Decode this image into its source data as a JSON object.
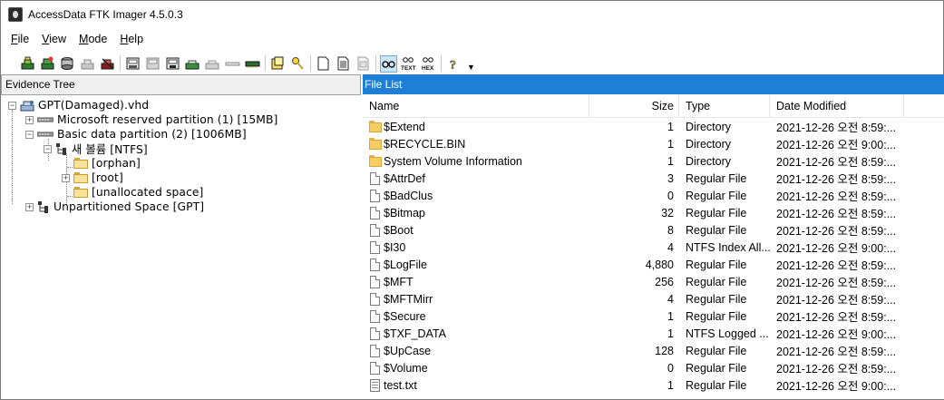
{
  "window": {
    "title": "AccessData FTK Imager 4.5.0.3"
  },
  "menu": [
    {
      "label_first": "F",
      "label_rest": "ile"
    },
    {
      "label_first": "V",
      "label_rest": "iew"
    },
    {
      "label_first": "M",
      "label_rest": "ode"
    },
    {
      "label_first": "H",
      "label_rest": "elp"
    }
  ],
  "toolbar": {
    "icons": [
      "add-evidence-icon",
      "add-all-evidence-icon",
      "image-mounting-icon",
      "remove-evidence-icon",
      "remove-all-evidence-icon",
      "create-disk-image-icon",
      "export-disk-image-icon",
      "export-logical-image-icon",
      "add-to-custom-content-icon",
      "create-custom-content-image-icon",
      "decrypt-icon",
      "capture-memory-icon",
      "obtain-protected-files-icon",
      "detect-efs-icon",
      "export-files-icon",
      "export-hash-list-icon",
      "verify-drive-icon",
      "view-files-icon",
      "view-file-preview-icon",
      "auto-mode-icon",
      "text-mode-icon",
      "hex-mode-icon",
      "help-icon"
    ],
    "text_label": "TEXT",
    "hex_label": "HEX"
  },
  "evidence_tree": {
    "header": "Evidence Tree",
    "items": [
      {
        "label": "GPT(Damaged).vhd",
        "expander": "−"
      },
      {
        "label": "Microsoft reserved partition (1) [15MB]",
        "expander": "+"
      },
      {
        "label": "Basic data partition (2) [1006MB]",
        "expander": "−"
      },
      {
        "label": "새 볼륨 [NTFS]",
        "expander": "−"
      },
      {
        "label": "[orphan]"
      },
      {
        "label": "[root]",
        "expander": "+"
      },
      {
        "label": "[unallocated space]"
      },
      {
        "label": "Unpartitioned Space [GPT]",
        "expander": "+"
      }
    ]
  },
  "file_list": {
    "header": "File List",
    "columns": {
      "name": "Name",
      "size": "Size",
      "type": "Type",
      "date": "Date Modified"
    },
    "rows": [
      {
        "icon": "folder",
        "name": "$Extend",
        "size": "1",
        "type": "Directory",
        "date": "2021-12-26 오전 8:59:..."
      },
      {
        "icon": "folder",
        "name": "$RECYCLE.BIN",
        "size": "1",
        "type": "Directory",
        "date": "2021-12-26 오전 9:00:..."
      },
      {
        "icon": "folder",
        "name": "System Volume Information",
        "size": "1",
        "type": "Directory",
        "date": "2021-12-26 오전 8:59:..."
      },
      {
        "icon": "file",
        "name": "$AttrDef",
        "size": "3",
        "type": "Regular File",
        "date": "2021-12-26 오전 8:59:..."
      },
      {
        "icon": "file",
        "name": "$BadClus",
        "size": "0",
        "type": "Regular File",
        "date": "2021-12-26 오전 8:59:..."
      },
      {
        "icon": "file",
        "name": "$Bitmap",
        "size": "32",
        "type": "Regular File",
        "date": "2021-12-26 오전 8:59:..."
      },
      {
        "icon": "file",
        "name": "$Boot",
        "size": "8",
        "type": "Regular File",
        "date": "2021-12-26 오전 8:59:..."
      },
      {
        "icon": "file",
        "name": "$I30",
        "size": "4",
        "type": "NTFS Index All...",
        "date": "2021-12-26 오전 9:00:..."
      },
      {
        "icon": "file",
        "name": "$LogFile",
        "size": "4,880",
        "type": "Regular File",
        "date": "2021-12-26 오전 8:59:..."
      },
      {
        "icon": "file",
        "name": "$MFT",
        "size": "256",
        "type": "Regular File",
        "date": "2021-12-26 오전 8:59:..."
      },
      {
        "icon": "file",
        "name": "$MFTMirr",
        "size": "4",
        "type": "Regular File",
        "date": "2021-12-26 오전 8:59:..."
      },
      {
        "icon": "file",
        "name": "$Secure",
        "size": "1",
        "type": "Regular File",
        "date": "2021-12-26 오전 8:59:..."
      },
      {
        "icon": "file",
        "name": "$TXF_DATA",
        "size": "1",
        "type": "NTFS Logged ...",
        "date": "2021-12-26 오전 9:00:..."
      },
      {
        "icon": "file",
        "name": "$UpCase",
        "size": "128",
        "type": "Regular File",
        "date": "2021-12-26 오전 8:59:..."
      },
      {
        "icon": "file",
        "name": "$Volume",
        "size": "0",
        "type": "Regular File",
        "date": "2021-12-26 오전 8:59:..."
      },
      {
        "icon": "text",
        "name": "test.txt",
        "size": "1",
        "type": "Regular File",
        "date": "2021-12-26 오전 9:00:..."
      }
    ]
  }
}
